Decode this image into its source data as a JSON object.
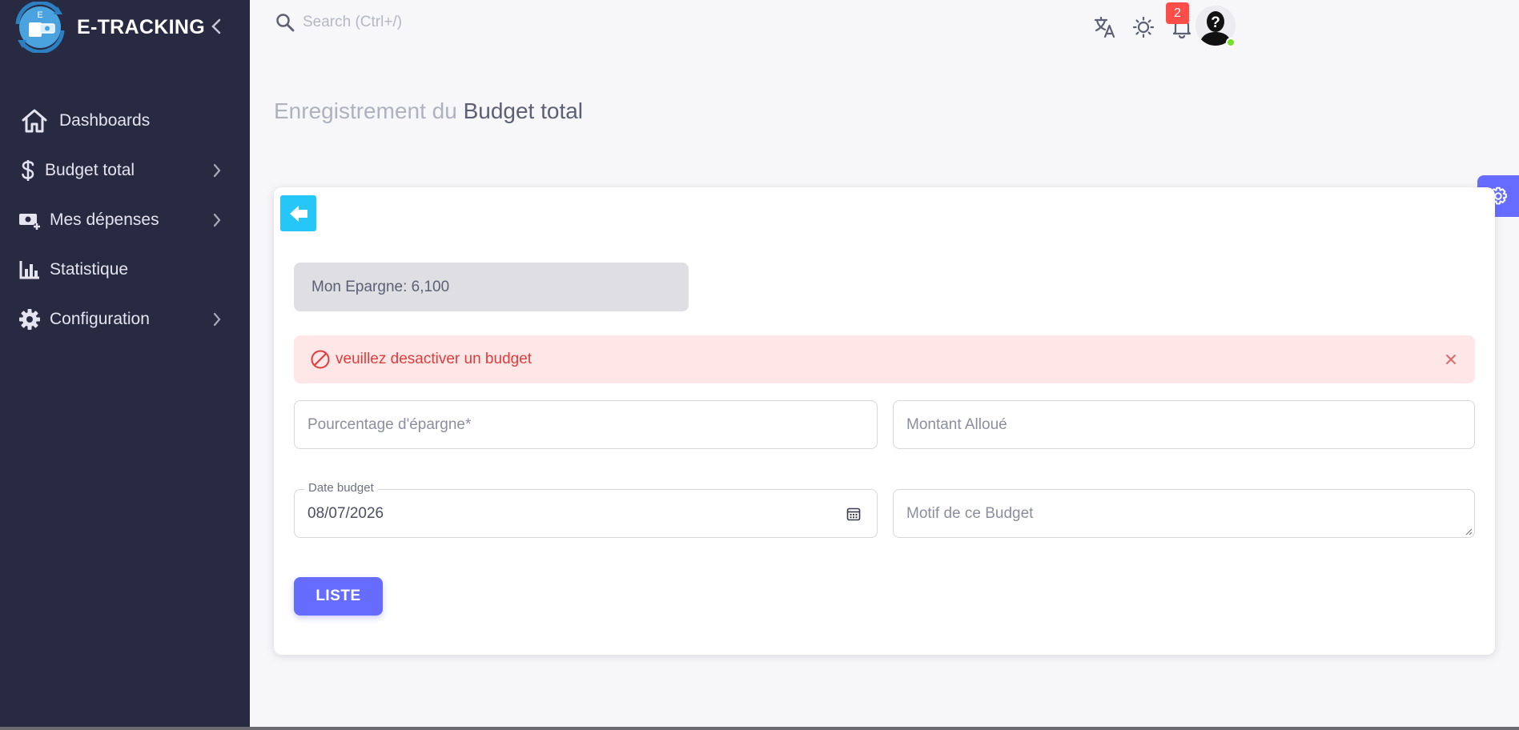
{
  "brand": {
    "name": "E-TRACKING",
    "logo_letter": "E"
  },
  "sidebar": {
    "items": [
      {
        "label": "Dashboards",
        "icon": "home-icon",
        "has_children": false
      },
      {
        "label": "Budget total",
        "icon": "dollar-icon",
        "has_children": true
      },
      {
        "label": "Mes dépenses",
        "icon": "cash-plus-icon",
        "has_children": true
      },
      {
        "label": "Statistique",
        "icon": "chart-bar-icon",
        "has_children": false
      },
      {
        "label": "Configuration",
        "icon": "gear-icon",
        "has_children": true
      }
    ]
  },
  "topbar": {
    "search_placeholder": "Search (Ctrl+/)",
    "notification_count": "2",
    "avatar_glyph": "?"
  },
  "page": {
    "title_prefix": "Enregistrement du",
    "title_main": "Budget total"
  },
  "form": {
    "epargne_text": "Mon Epargne: 6,100",
    "alert_text": "veuillez desactiver un budget",
    "pourcentage_placeholder": "Pourcentage d'épargne*",
    "montant_placeholder": "Montant Alloué",
    "date_label": "Date budget",
    "date_value": "08/07/2026",
    "motif_placeholder": "Motif de ce Budget",
    "liste_button": "LISTE"
  },
  "colors": {
    "sidebar_bg": "#282a42",
    "primary": "#666cff",
    "info": "#26c6f9",
    "error": "#ff4d49",
    "online": "#72e128"
  }
}
